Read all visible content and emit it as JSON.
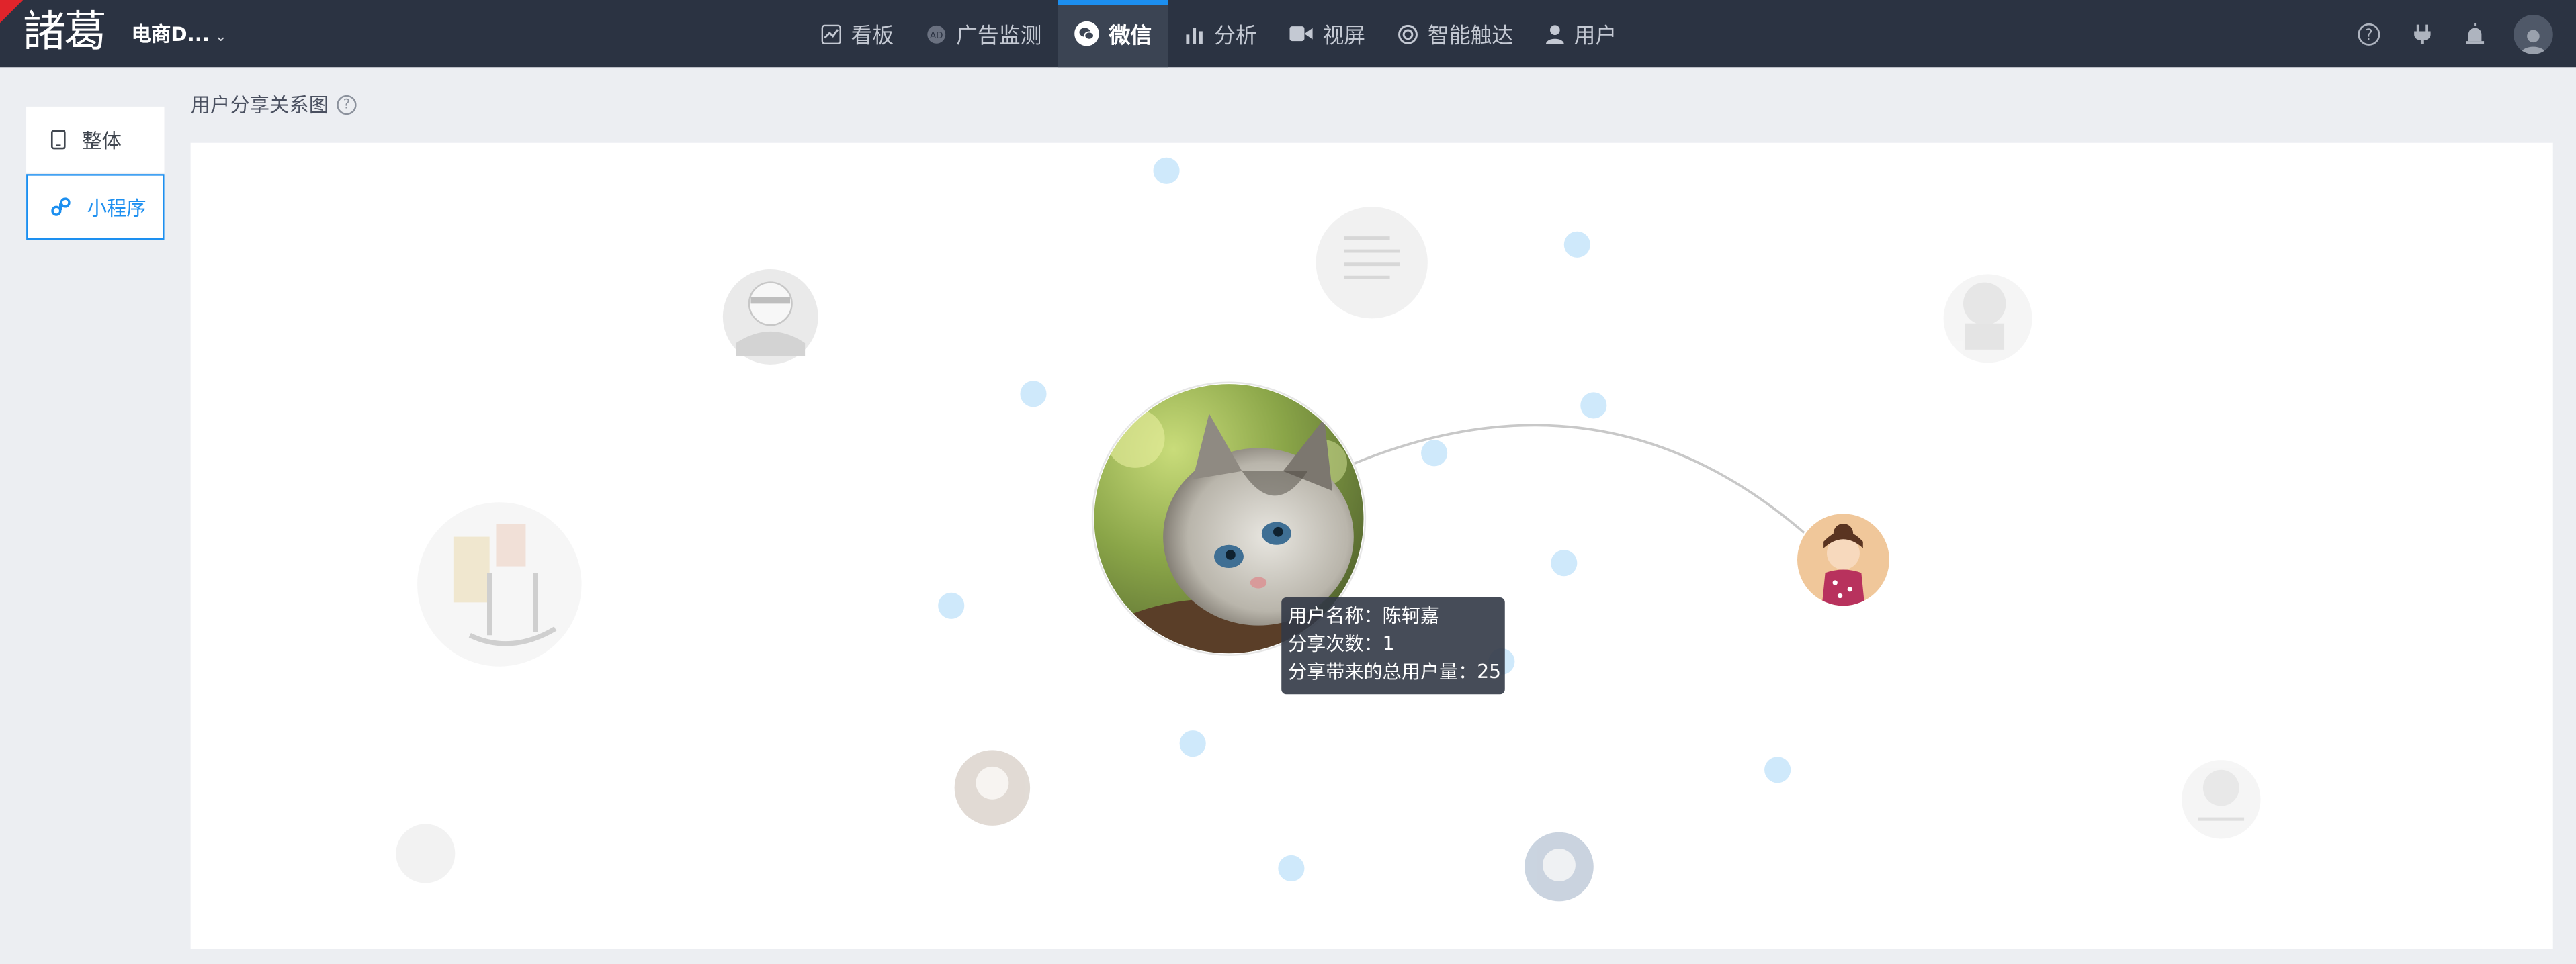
{
  "brand": {
    "logo_text": "諸葛",
    "project": "电商D...",
    "accent": "#1c8ff0"
  },
  "nav": {
    "items": [
      {
        "label": "看板",
        "icon": "chart-board-icon"
      },
      {
        "label": "广告监测",
        "icon": "ad-icon"
      },
      {
        "label": "微信",
        "icon": "wechat-icon",
        "active": true
      },
      {
        "label": "分析",
        "icon": "bar-chart-icon"
      },
      {
        "label": "视屏",
        "icon": "video-camera-icon"
      },
      {
        "label": "智能触达",
        "icon": "target-icon"
      },
      {
        "label": "用户",
        "icon": "user-icon"
      }
    ]
  },
  "toolbar": {
    "icons": [
      "help-icon",
      "plugin-icon",
      "alarm-icon",
      "account-avatar"
    ]
  },
  "sidebar": {
    "items": [
      {
        "label": "整体",
        "icon": "mobile-icon"
      },
      {
        "label": "小程序",
        "icon": "mini-program-icon",
        "active": true
      }
    ]
  },
  "section": {
    "title": "用户分享关系图",
    "help_icon": "help-icon"
  },
  "tooltip": {
    "line1": "用户名称：陈轲嘉",
    "line2": "分享次数：1",
    "line3": "分享带来的总用户量：25"
  },
  "graph": {
    "center_user": "cat-photo-avatar",
    "connected_user": "girl-avatar",
    "node_color": "#cfe9fb",
    "edge_color": "#c8c8c8"
  }
}
